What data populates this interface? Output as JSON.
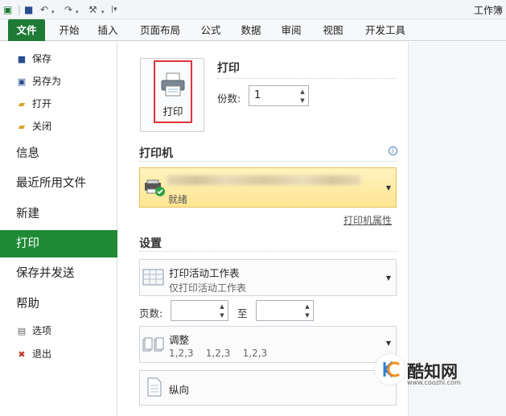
{
  "window": {
    "title": "工作簿"
  },
  "ribbon_tabs": [
    "文件",
    "开始",
    "插入",
    "页面布局",
    "公式",
    "数据",
    "审阅",
    "视图",
    "开发工具"
  ],
  "nav": {
    "save": "保存",
    "save_as": "另存为",
    "open": "打开",
    "close": "关闭",
    "info": "信息",
    "recent": "最近所用文件",
    "new": "新建",
    "print": "打印",
    "save_send": "保存并发送",
    "help": "帮助",
    "options": "选项",
    "exit": "退出"
  },
  "print_panel": {
    "print_button_label": "打印",
    "heading": "打印",
    "copies_label": "份数:",
    "copies_value": "1"
  },
  "printer": {
    "section_title": "打印机",
    "status": "就绪",
    "properties_link": "打印机属性"
  },
  "settings": {
    "section_title": "设置",
    "scope_title": "打印活动工作表",
    "scope_desc": "仅打印活动工作表",
    "pages_label": "页数:",
    "to_label": "至",
    "collate_title": "调整",
    "collate_desc": "1,2,3    1,2,3    1,2,3",
    "orientation": "纵向"
  },
  "watermark": {
    "name": "酷知网",
    "url": "www.coozhi.com"
  },
  "colors": {
    "accent_green": "#1f8a35",
    "highlight_red": "#e0343b",
    "printer_yellow": "#fde592"
  }
}
